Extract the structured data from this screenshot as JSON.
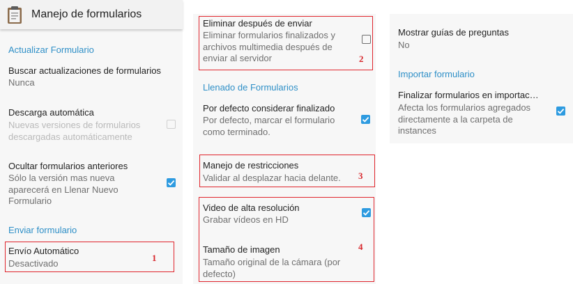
{
  "header": {
    "title": "Manejo de formularios",
    "icon": "clipboard-icon"
  },
  "col1": {
    "cat_update": "Actualizar Formulario",
    "check_updates": {
      "title": "Buscar actualizaciones de formularios",
      "value": "Nunca"
    },
    "auto_download": {
      "title": "Descarga automática",
      "summary": "Nuevas versiones de formularios descargadas automáticamente",
      "checked": false,
      "enabled": false
    },
    "hide_old": {
      "title": "Ocultar formularios anteriores",
      "summary": "Sólo la versión mas nueva aparecerá en Llenar Nuevo Formulario",
      "checked": true
    },
    "cat_send": "Enviar formulario",
    "auto_send": {
      "title": "Envío Automático",
      "value": "Desactivado"
    }
  },
  "col2": {
    "delete_after": {
      "title": "Eliminar después de enviar",
      "summary": "Eliminar formularios finalizados y archivos multimedia después de enviar al servidor",
      "checked": false
    },
    "cat_filling": "Llenado de Formularios",
    "default_complete": {
      "title": "Por defecto considerar finalizado",
      "summary": "Por defecto, marcar el formulario como terminado.",
      "checked": true
    },
    "constraint": {
      "title": "Manejo de restricciones",
      "summary": "Validar al desplazar hacia delante."
    },
    "hi_res_video": {
      "title": "Video de alta resolución",
      "summary": "Grabar vídeos en HD",
      "checked": true
    },
    "image_size": {
      "title": "Tamaño de imagen",
      "summary": "Tamaño original de la cámara (por defecto)"
    }
  },
  "col3": {
    "guidance": {
      "title": "Mostrar guías de preguntas",
      "value": "No"
    },
    "cat_import": "Importar formulario",
    "finalize_import": {
      "title": "Finalizar formularios en importac…",
      "summary": "Afecta los formularios agregados directamente a la carpeta de instances",
      "checked": true
    }
  },
  "annotations": [
    "1",
    "2",
    "3",
    "4"
  ],
  "colors": {
    "accent": "#2e8fc7",
    "checkbox": "#2e9be0",
    "annotation": "#e0242c"
  }
}
